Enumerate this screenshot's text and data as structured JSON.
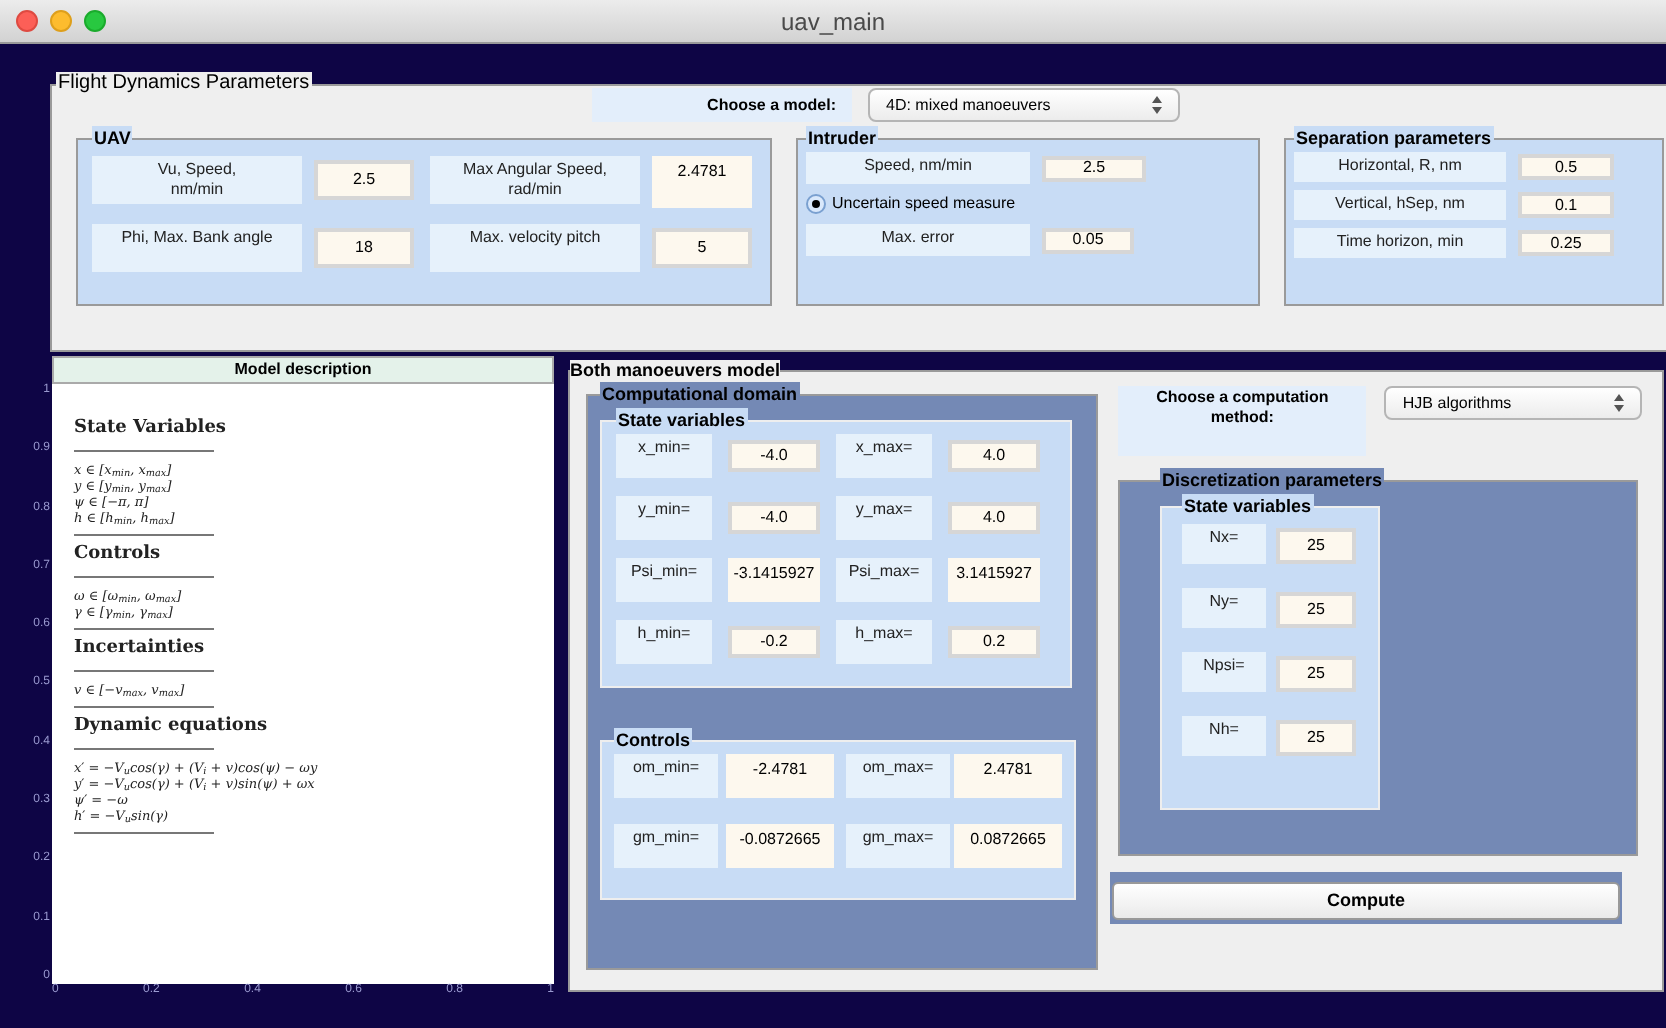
{
  "window": {
    "title": "uav_main"
  },
  "flight_panel": {
    "title": "Flight Dynamics Parameters",
    "model_label": "Choose a model:",
    "model_select": "4D: mixed manoeuvers",
    "uav": {
      "title": "UAV",
      "fields": [
        {
          "label": "Vu, Speed,\nnm/min",
          "value": "2.5",
          "kind": "input"
        },
        {
          "label": "Max Angular Speed,\nrad/min",
          "value": "2.4781",
          "kind": "text"
        },
        {
          "label": "Phi, Max. Bank angle",
          "value": "18",
          "kind": "input"
        },
        {
          "label": "Max. velocity pitch",
          "value": "5",
          "kind": "input"
        }
      ]
    },
    "intruder": {
      "title": "Intruder",
      "speed": {
        "label": "Speed, nm/min",
        "value": "2.5"
      },
      "uncertain": {
        "label": "Uncertain speed measure",
        "selected": true
      },
      "error": {
        "label": "Max. error",
        "value": "0.05"
      }
    },
    "separation": {
      "title": "Separation parameters",
      "fields": [
        {
          "label": "Horizontal, R, nm",
          "value": "0.5"
        },
        {
          "label": "Vertical, hSep, nm",
          "value": "0.1"
        },
        {
          "label": "Time horizon, min",
          "value": "0.25"
        }
      ]
    }
  },
  "model_description": {
    "title": "Model description",
    "y_ticks": [
      "1",
      "0.9",
      "0.8",
      "0.7",
      "0.6",
      "0.5",
      "0.4",
      "0.3",
      "0.2",
      "0.1",
      "0"
    ],
    "x_ticks": [
      "0",
      "0.2",
      "0.4",
      "0.6",
      "0.8",
      "1"
    ],
    "sections": [
      {
        "heading": "State Variables",
        "lines": [
          "x ∈ [x$_{min}$, x$_{max}$]",
          "y ∈ [y$_{min}$, y$_{max}$]",
          "ψ ∈ [−π, π]",
          "h ∈ [h$_{min}$, h$_{max}$]"
        ]
      },
      {
        "heading": "Controls",
        "lines": [
          "ω ∈ [ω$_{min}$, ω$_{max}$]",
          "γ ∈ [γ$_{min}$, γ$_{max}$]"
        ]
      },
      {
        "heading": "Incertainties",
        "lines": [
          "v ∈ [−v$_{max}$, v$_{max}$]"
        ]
      },
      {
        "heading": "Dynamic equations",
        "lines": [
          "x′ = −V$_{u}$cos(γ) + (V$_{i}$ + v)cos(ψ) − ωy",
          "y′ = −V$_{u}$cos(γ) + (V$_{i}$ + v)sin(ψ) + ωx",
          "ψ′ = −ω",
          "h′ = −V$_{u}$sin(γ)"
        ]
      }
    ]
  },
  "model_panel": {
    "title": "Both manoeuvers model",
    "domain": {
      "title": "Computational domain",
      "state": {
        "title": "State variables",
        "fields": [
          {
            "label": "x_min=",
            "value": "-4.0",
            "kind": "input"
          },
          {
            "label": "x_max=",
            "value": "4.0",
            "kind": "input"
          },
          {
            "label": "y_min=",
            "value": "-4.0",
            "kind": "input"
          },
          {
            "label": "y_max=",
            "value": "4.0",
            "kind": "input"
          },
          {
            "label": "Psi_min=",
            "value": "-3.1415927",
            "kind": "text"
          },
          {
            "label": "Psi_max=",
            "value": "3.1415927",
            "kind": "text"
          },
          {
            "label": "h_min=",
            "value": "-0.2",
            "kind": "input"
          },
          {
            "label": "h_max=",
            "value": "0.2",
            "kind": "input"
          }
        ]
      },
      "controls": {
        "title": "Controls",
        "fields": [
          {
            "label": "om_min=",
            "value": "-2.4781"
          },
          {
            "label": "om_max=",
            "value": "2.4781"
          },
          {
            "label": "gm_min=",
            "value": "-0.0872665"
          },
          {
            "label": "gm_max=",
            "value": "0.0872665"
          }
        ]
      }
    },
    "method_label": "Choose a computation\nmethod:",
    "method_select": "HJB algorithms",
    "discretization": {
      "title": "Discretization parameters",
      "state_title": "State variables",
      "fields": [
        {
          "label": "Nx=",
          "value": "25"
        },
        {
          "label": "Ny=",
          "value": "25"
        },
        {
          "label": "Npsi=",
          "value": "25"
        },
        {
          "label": "Nh=",
          "value": "25"
        }
      ]
    },
    "compute_button": "Compute"
  }
}
